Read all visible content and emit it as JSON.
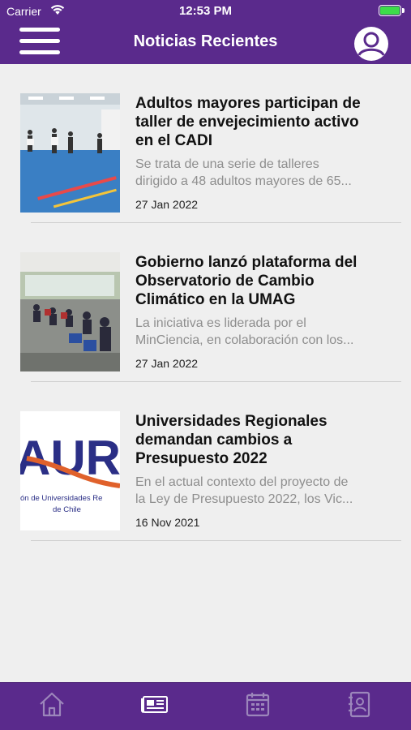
{
  "status_bar": {
    "carrier": "Carrier",
    "time": "12:53 PM"
  },
  "header": {
    "title": "Noticias Recientes",
    "menu_icon": "hamburger-menu-icon",
    "profile_icon": "user-profile-icon"
  },
  "colors": {
    "brand": "#5a2a8c",
    "summary": "#8e8e8e",
    "battery": "#3ddc4a"
  },
  "news": [
    {
      "title_lines": [
        "Adultos mayores participan de",
        "taller de envejecimiento activo",
        "en el CADI"
      ],
      "summary_lines": [
        "Se trata de una serie de talleres",
        "dirigido a 48 adultos mayores de 65..."
      ],
      "date": "27 Jan 2022"
    },
    {
      "title_lines": [
        "Gobierno lanzó plataforma del",
        "Observatorio de Cambio",
        "Climático en la UMAG"
      ],
      "summary_lines": [
        "La iniciativa es liderada por el",
        "MinCiencia, en colaboración con los..."
      ],
      "date": "27 Jan 2022"
    },
    {
      "title_lines": [
        "Universidades Regionales",
        "demandan cambios a",
        "Presupuesto 2022"
      ],
      "summary_lines": [
        "En el actual contexto del proyecto de",
        "la Ley de Presupuesto 2022, los Vic..."
      ],
      "date": "16 Nov 2021",
      "image_text": {
        "logo": "AUR",
        "line1": "ón de Universidades Re",
        "line2": "de Chile"
      }
    }
  ],
  "tabbar": [
    "home-icon",
    "newspaper-icon",
    "calendar-icon",
    "contact-book-icon"
  ]
}
